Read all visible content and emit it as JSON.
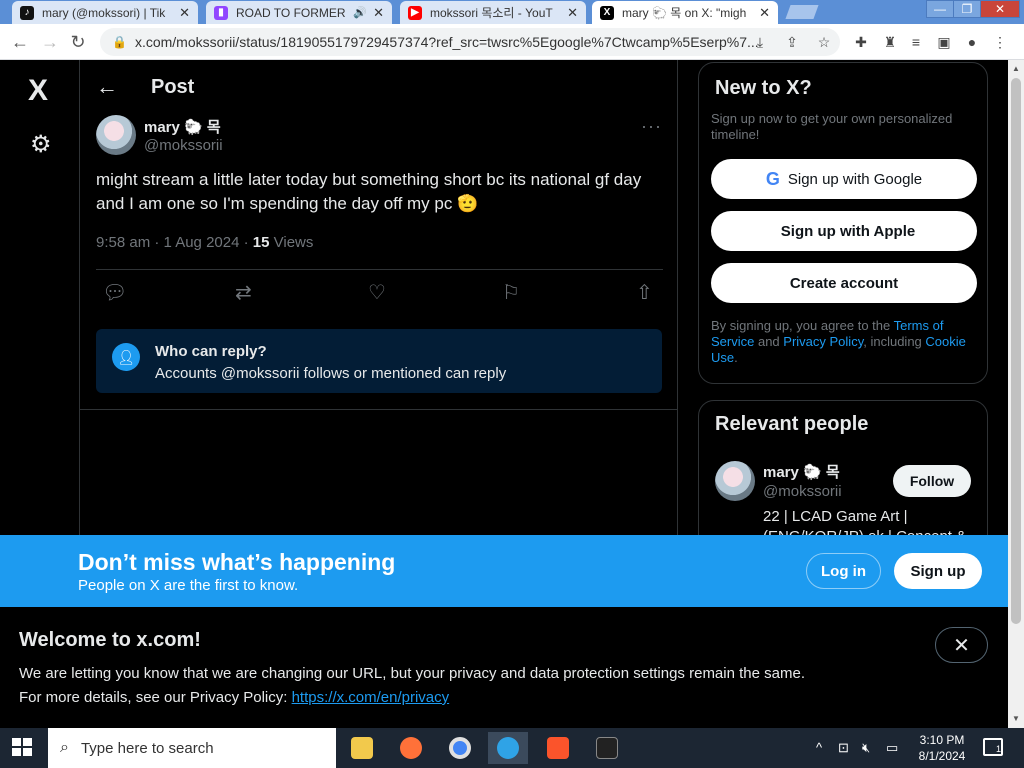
{
  "browser": {
    "tabs": [
      {
        "title": "mary (@mokssori) | Tik",
        "icon": "tiktok-icon",
        "active": false
      },
      {
        "title": "ROAD TO FORMER",
        "icon": "twitch-icon",
        "active": false
      },
      {
        "title": "mokssori 목소리 - YouT",
        "icon": "youtube-icon",
        "active": false
      },
      {
        "title": "mary 🐑 목 on X: \"migh",
        "icon": "x-icon",
        "active": true
      }
    ],
    "url": "x.com/mokssorii/status/1819055179729457374?ref_src=twsrc%5Egoogle%7Ctwcamp%5Eserp%7..."
  },
  "nav": {
    "logo": "X",
    "settings_icon": "gear-icon"
  },
  "header": {
    "back": "←",
    "title": "Post"
  },
  "post": {
    "author_name": "mary 🐑 목",
    "handle": "@mokssorii",
    "text": "might stream a little later today but something short bc its national gf day and I am one so I'm spending the day off my pc 🫡",
    "time": "9:58 am · 1 Aug 2024 · ",
    "views_count": "15",
    "views_label": " Views",
    "reply_box": {
      "title": "Who can reply?",
      "text": "Accounts @mokssorii follows or mentioned can reply"
    }
  },
  "sidebar": {
    "new_to_x": {
      "title": "New to X?",
      "subtitle": "Sign up now to get your own personalized timeline!",
      "google_label": "Sign up with Google",
      "apple_label": "Sign up with Apple",
      "create_label": "Create account",
      "terms_prefix": "By signing up, you agree to the ",
      "terms_link": "Terms of Service",
      "terms_and": " and ",
      "privacy_link": "Privacy Policy",
      "terms_mid": ", including ",
      "cookie_link": "Cookie Use",
      "terms_end": "."
    },
    "relevant_people": {
      "title": "Relevant people",
      "name": "mary 🐑 목",
      "handle": "@mokssorii",
      "follow_label": "Follow",
      "bio": "22 | LCAD Game Art | (ENG/KOR/JP) ok | Concept &"
    }
  },
  "banner": {
    "title": "Don’t miss what’s happening",
    "subtitle": "People on X are the first to know.",
    "login": "Log in",
    "signup": "Sign up"
  },
  "notice": {
    "title": "Welcome to x.com!",
    "line1": "We are letting you know that we are changing our URL, but your privacy and data protection settings remain the same.",
    "line2_prefix": "For more details, see our Privacy Policy: ",
    "line2_link": "https://x.com/en/privacy",
    "close": "✕"
  },
  "taskbar": {
    "search_placeholder": "Type here to search",
    "time": "3:10 PM",
    "date": "8/1/2024",
    "notification_count": "1"
  },
  "colors": {
    "accent": "#1d9bf0",
    "background": "#000000",
    "reply_box": "#031d36"
  }
}
